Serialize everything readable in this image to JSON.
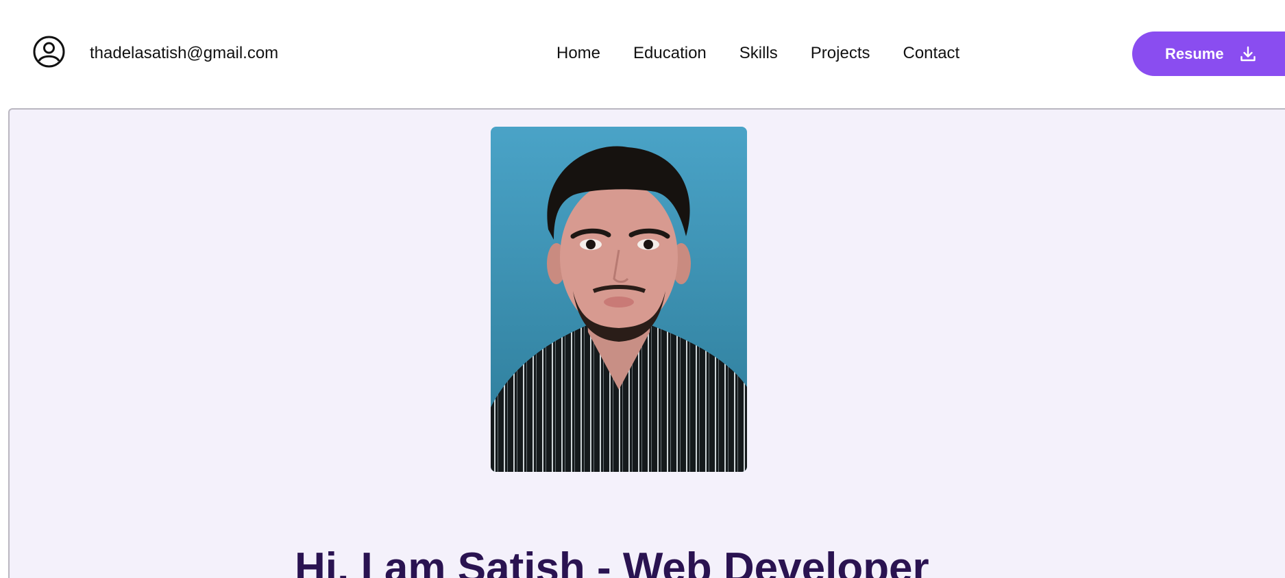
{
  "header": {
    "email": "thadelasatish@gmail.com",
    "user_icon": "user-circle-icon",
    "nav": [
      {
        "label": "Home"
      },
      {
        "label": "Education"
      },
      {
        "label": "Skills"
      },
      {
        "label": "Projects"
      },
      {
        "label": "Contact"
      }
    ],
    "resume_label": "Resume",
    "resume_icon": "download-icon"
  },
  "hero": {
    "headline": "Hi, I am Satish - Web Developer"
  },
  "colors": {
    "accent": "#8a4df0",
    "hero_bg": "#f4f1fb",
    "headline": "#2a1351",
    "photo_bg": "#3d94b6"
  }
}
